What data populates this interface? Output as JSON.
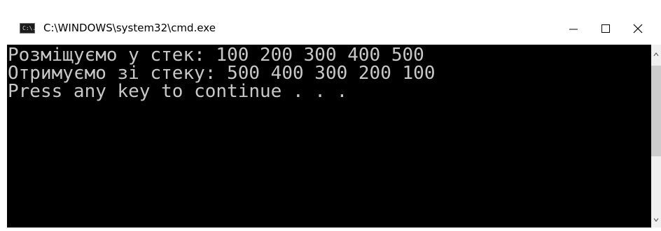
{
  "window": {
    "title": "C:\\WINDOWS\\system32\\cmd.exe",
    "icon_text": "C:\\.",
    "icon": "cmd-console-icon",
    "controls": {
      "minimize_icon": "minimize-icon",
      "maximize_icon": "maximize-icon",
      "close_icon": "close-icon"
    }
  },
  "console": {
    "lines": [
      "Розміщуємо у стек: 100 200 300 400 500",
      "Отримуємо зі стеку: 500 400 300 200 100",
      "Press any key to continue . . ."
    ],
    "text_color": "#c0c0c0",
    "background": "#000000"
  },
  "scrollbar": {
    "up_icon": "scroll-up-arrow-icon",
    "down_icon": "scroll-down-arrow-icon"
  }
}
